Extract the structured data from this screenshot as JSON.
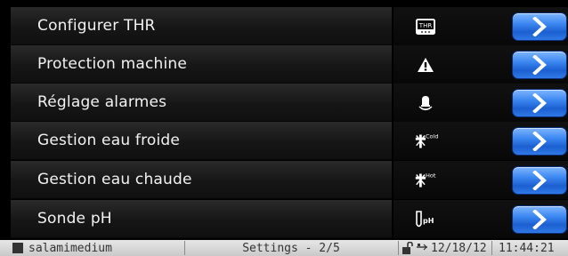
{
  "menu": {
    "items": [
      {
        "label": "Configurer THR",
        "icon": "thr-icon",
        "icon_text": "THR"
      },
      {
        "label": "Protection machine",
        "icon": "warning-icon"
      },
      {
        "label": "Réglage alarmes",
        "icon": "alarm-bell-icon"
      },
      {
        "label": "Gestion eau froide",
        "icon": "cold-water-icon",
        "icon_text": "Cold"
      },
      {
        "label": "Gestion eau chaude",
        "icon": "hot-water-icon",
        "icon_text": "Hot"
      },
      {
        "label": "Sonde pH",
        "icon": "ph-probe-icon",
        "icon_text": "pH"
      }
    ],
    "button_icon": "chevron-right-icon"
  },
  "status_bar": {
    "user": "salamimedium",
    "page": "Settings - 2/5",
    "date": "12/18/12",
    "time": "11:44:21",
    "icons": [
      "unlocked-padlock-icon",
      "usb-icon"
    ]
  },
  "colors": {
    "button_blue": "#2f79e6",
    "row_background": "#1a1a1a",
    "status_bar": "#d6d6d6"
  }
}
